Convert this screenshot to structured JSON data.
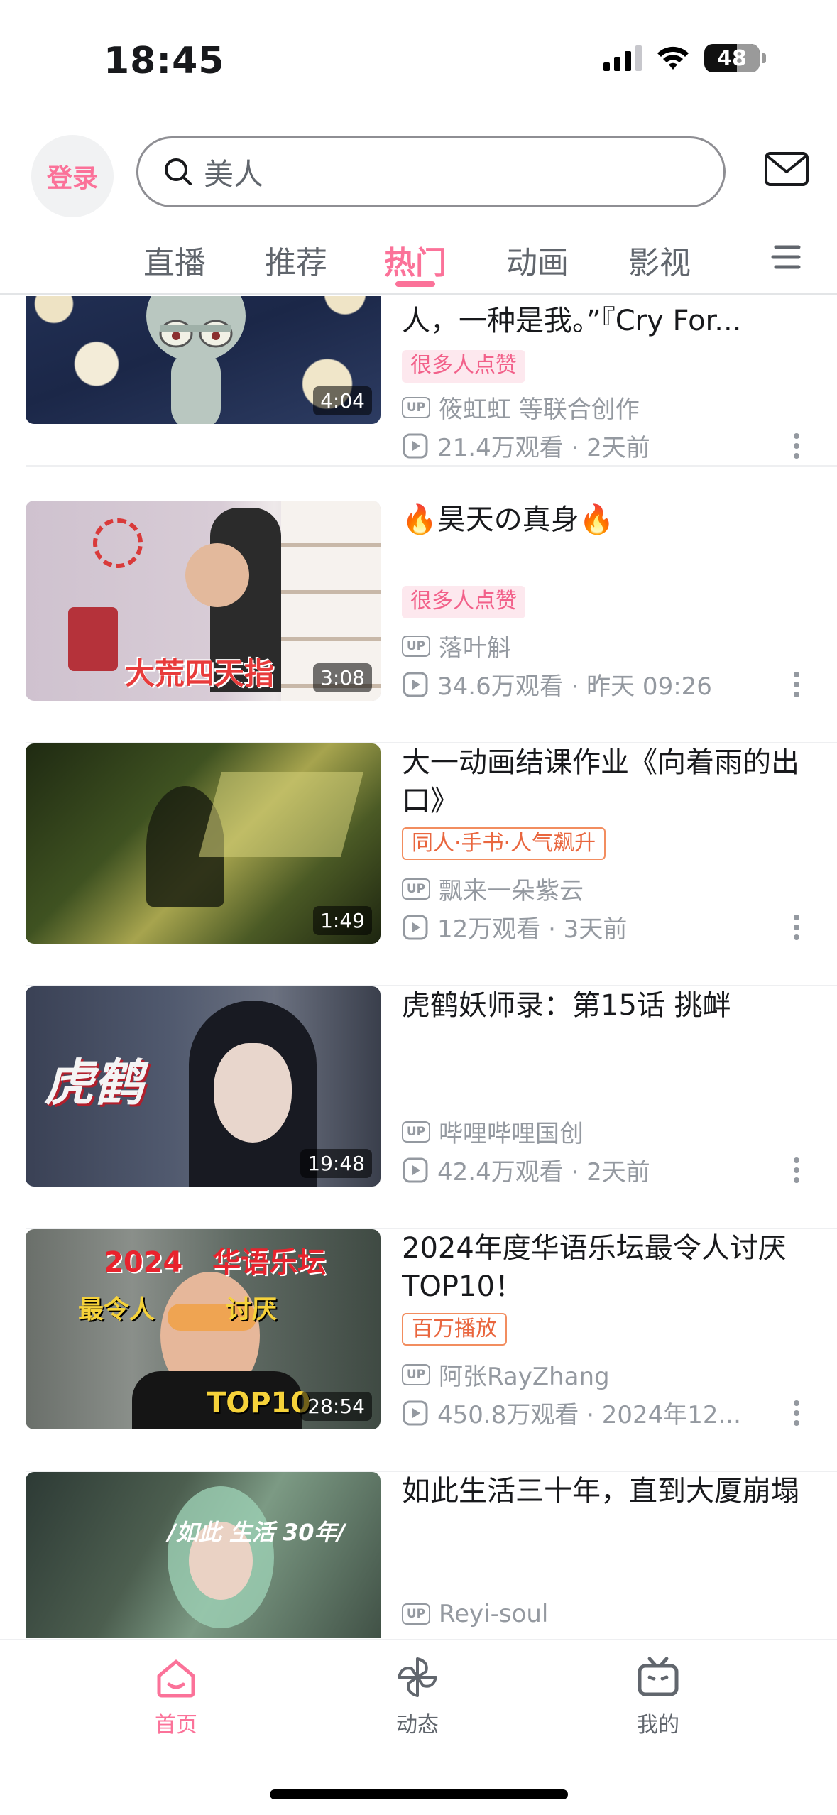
{
  "status_bar": {
    "time": "18:45",
    "battery": "48"
  },
  "header": {
    "login_label": "登录",
    "search_text": "美人"
  },
  "tabs": [
    {
      "label": "直播",
      "active": false
    },
    {
      "label": "推荐",
      "active": false
    },
    {
      "label": "热门",
      "active": true
    },
    {
      "label": "动画",
      "active": false
    },
    {
      "label": "影视",
      "active": false
    }
  ],
  "feed": [
    {
      "title": "人，一种是我。”『Cry For...",
      "badge": "很多人点赞",
      "author": "筱虹虹 等联合创作",
      "views": "21.4万观看 · 2天前",
      "duration": "4:04"
    },
    {
      "title": "🔥昊天の真身🔥",
      "badge": "很多人点赞",
      "author": "落叶斛",
      "views": "34.6万观看 · 昨天 09:26",
      "duration": "3:08",
      "overlay": "大荒四天指"
    },
    {
      "title": "大一动画结课作业《向着雨的出口》",
      "badge": "同人·手书·人气飙升",
      "author": "飘来一朵紫云",
      "views": "12万观看 · 3天前",
      "duration": "1:49"
    },
    {
      "title": "虎鹤妖师录：第15话 挑衅",
      "author": "哔哩哔哩国创",
      "views": "42.4万观看 · 2天前",
      "duration": "19:48",
      "overlay": "虎鹤"
    },
    {
      "title": "2024年度华语乐坛最令人讨厌TOP10！",
      "badge": "百万播放",
      "author": "阿张RayZhang",
      "views": "450.8万观看 · 2024年12...",
      "duration": "28:54",
      "overlay_top": "2024   华语乐坛",
      "overlay_mid": "最令人        讨厌",
      "overlay_bottom": "TOP10"
    },
    {
      "title": "如此生活三十年，直到大厦崩塌",
      "author": "Reyi-soul",
      "overlay": "/如此 生活 30年/"
    }
  ],
  "bottom_nav": [
    {
      "label": "首页",
      "icon": "home-icon",
      "active": true
    },
    {
      "label": "动态",
      "icon": "pinwheel-icon",
      "active": false
    },
    {
      "label": "我的",
      "icon": "tv-icon",
      "active": false
    }
  ],
  "colors": {
    "accent": "#fb7299",
    "badge_orange": "#e9663e"
  }
}
